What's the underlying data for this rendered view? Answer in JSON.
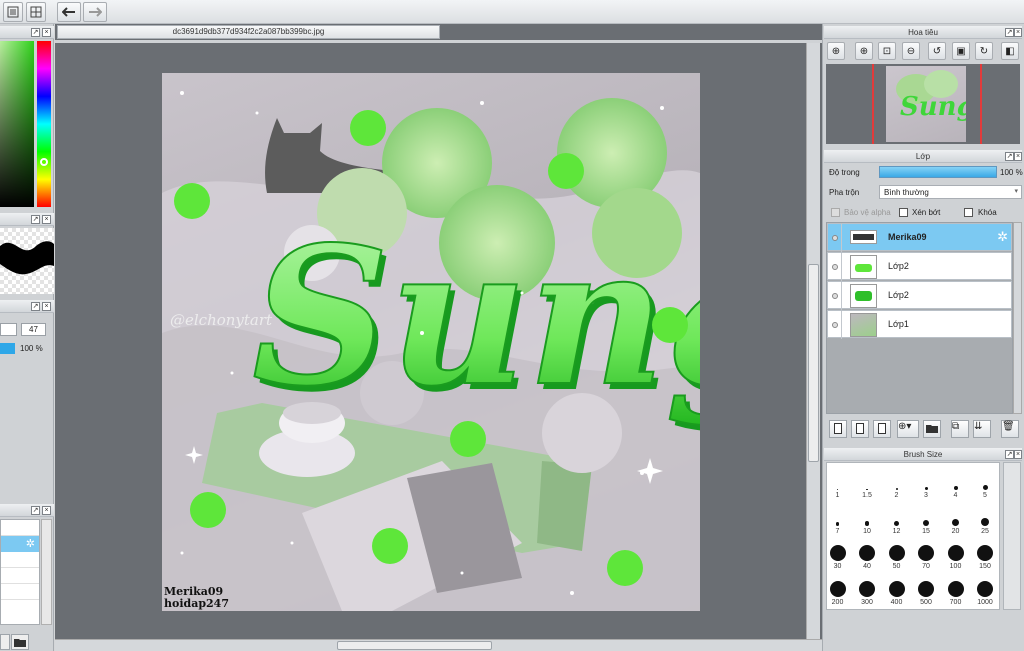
{
  "file_tab": {
    "name": "dc3691d9db377d934f2c2a087bb399bc.jpg"
  },
  "left": {
    "size_value": "47",
    "opacity_value": "100 %"
  },
  "navigator": {
    "title": "Hoa tiêu"
  },
  "layer_panel": {
    "title": "Lớp",
    "opacity_label": "Độ trong",
    "opacity_value": "100 %",
    "blend_label": "Pha trộn",
    "blend_value": "Bình thường",
    "protect_alpha": "Bảo vệ alpha",
    "clipping": "Xén bớt",
    "lock": "Khóa",
    "layers": [
      {
        "name": "Merika09",
        "selected": true
      },
      {
        "name": "Lớp2",
        "selected": false
      },
      {
        "name": "Lớp2",
        "selected": false
      },
      {
        "name": "Lớp1",
        "selected": false
      }
    ]
  },
  "brush_size": {
    "title": "Brush Size",
    "sizes": [
      "1",
      "1.5",
      "2",
      "3",
      "4",
      "5",
      "7",
      "10",
      "12",
      "15",
      "20",
      "25",
      "30",
      "40",
      "50",
      "70",
      "100",
      "150",
      "200",
      "300",
      "400",
      "500",
      "700",
      "1000"
    ]
  },
  "artwork": {
    "title_text": "Sung",
    "watermark": "@elchonytart",
    "signature_line1": "Merika09",
    "signature_line2": "hoidap247"
  },
  "colors": {
    "accent": "#7cc9f2",
    "canvas_bg": "#6a6e73",
    "green": "#5ee63a"
  }
}
